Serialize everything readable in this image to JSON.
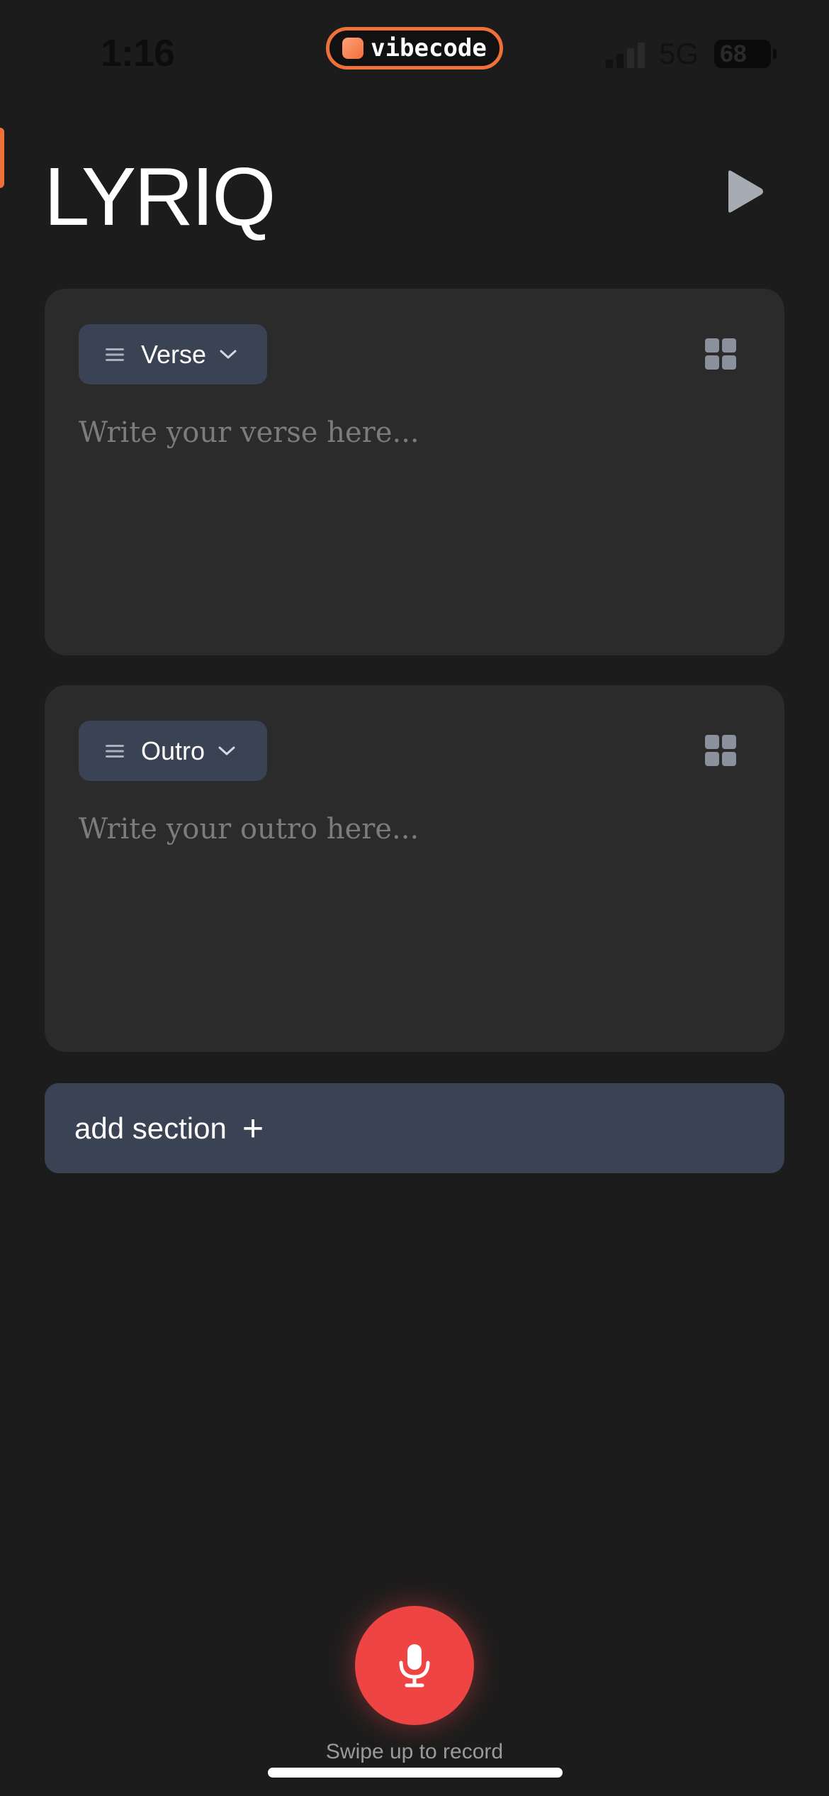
{
  "status_bar": {
    "time": "1:16",
    "island_label": "vibecode",
    "network": "5G",
    "battery": "68"
  },
  "header": {
    "title": "LYRIQ",
    "play_icon": "play-icon"
  },
  "sections": [
    {
      "type_label": "Verse",
      "placeholder": "Write your verse here...",
      "value": ""
    },
    {
      "type_label": "Outro",
      "placeholder": "Write your outro here...",
      "value": ""
    }
  ],
  "add_section": {
    "label": "add section",
    "plus": "+"
  },
  "record": {
    "icon": "microphone-icon",
    "hint": "Swipe up to record"
  },
  "colors": {
    "background": "#1c1c1c",
    "card": "#2b2b2b",
    "pill": "#3a4354",
    "record": "#ef4444",
    "island_accent": "#f0703a"
  }
}
